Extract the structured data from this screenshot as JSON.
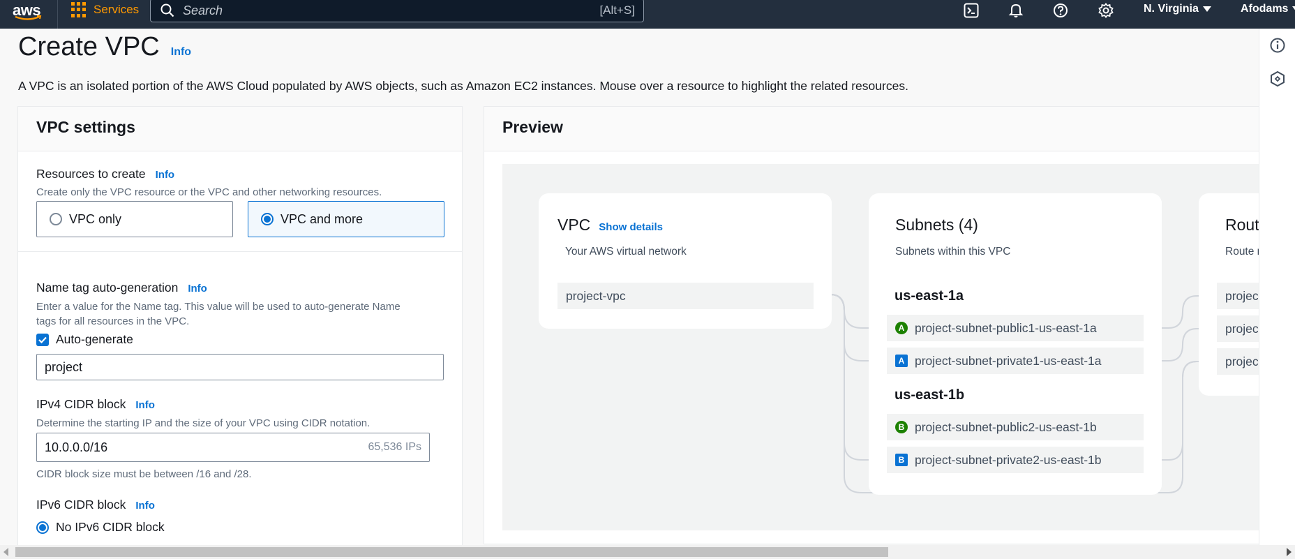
{
  "topnav": {
    "logo_text": "aws",
    "services_label": "Services",
    "search_placeholder": "Search",
    "search_shortcut": "[Alt+S]",
    "region": "N. Virginia",
    "account": "Afodams",
    "icons": [
      "cloudshell-icon",
      "bell-icon",
      "help-icon",
      "settings-gear-icon"
    ],
    "accent_color": "#ff9900"
  },
  "page": {
    "title": "Create VPC",
    "title_info": "Info",
    "description": "A VPC is an isolated portion of the AWS Cloud populated by AWS objects, such as Amazon EC2 instances. Mouse over a resource to highlight the related resources."
  },
  "settings": {
    "header": "VPC settings",
    "resources": {
      "label": "Resources to create",
      "info": "Info",
      "help": "Create only the VPC resource or the VPC and other networking resources.",
      "options": [
        {
          "label": "VPC only",
          "selected": false
        },
        {
          "label": "VPC and more",
          "selected": true
        }
      ]
    },
    "name_tag": {
      "label": "Name tag auto-generation",
      "info": "Info",
      "help_line1": "Enter a value for the Name tag. This value will be used to auto-generate Name",
      "help_line2": "tags for all resources in the VPC.",
      "checkbox_label": "Auto-generate",
      "checked": true,
      "value": "project"
    },
    "ipv4": {
      "label": "IPv4 CIDR block",
      "info": "Info",
      "help": "Determine the starting IP and the size of your VPC using CIDR notation.",
      "value": "10.0.0.0/16",
      "suffix": "65,536 IPs",
      "constraint": "CIDR block size must be between /16 and /28."
    },
    "ipv6": {
      "label": "IPv6 CIDR block",
      "info": "Info",
      "option": "No IPv6 CIDR block",
      "selected": true
    }
  },
  "preview": {
    "header": "Preview",
    "vpc_card": {
      "title": "VPC",
      "link": "Show details",
      "subtitle": "Your AWS virtual network",
      "resource": "project-vpc"
    },
    "subnets_card": {
      "title": "Subnets (4)",
      "subtitle": "Subnets within this VPC",
      "zones": [
        {
          "name": "us-east-1a",
          "subnets": [
            {
              "badge": "A",
              "type": "public",
              "name": "project-subnet-public1-us-east-1a"
            },
            {
              "badge": "A",
              "type": "private",
              "name": "project-subnet-private1-us-east-1a"
            }
          ]
        },
        {
          "name": "us-east-1b",
          "subnets": [
            {
              "badge": "B",
              "type": "public",
              "name": "project-subnet-public2-us-east-1b"
            },
            {
              "badge": "B",
              "type": "private",
              "name": "project-subnet-private2-us-east-1b"
            }
          ]
        }
      ]
    },
    "route_card": {
      "title": "Rout",
      "subtitle": "Route r",
      "items": [
        "projec",
        "projec",
        "projec"
      ]
    }
  },
  "colors": {
    "link": "#0972d3",
    "public_badge": "#1d8102",
    "private_badge": "#0972d3",
    "nav_bg": "#232f3e"
  }
}
